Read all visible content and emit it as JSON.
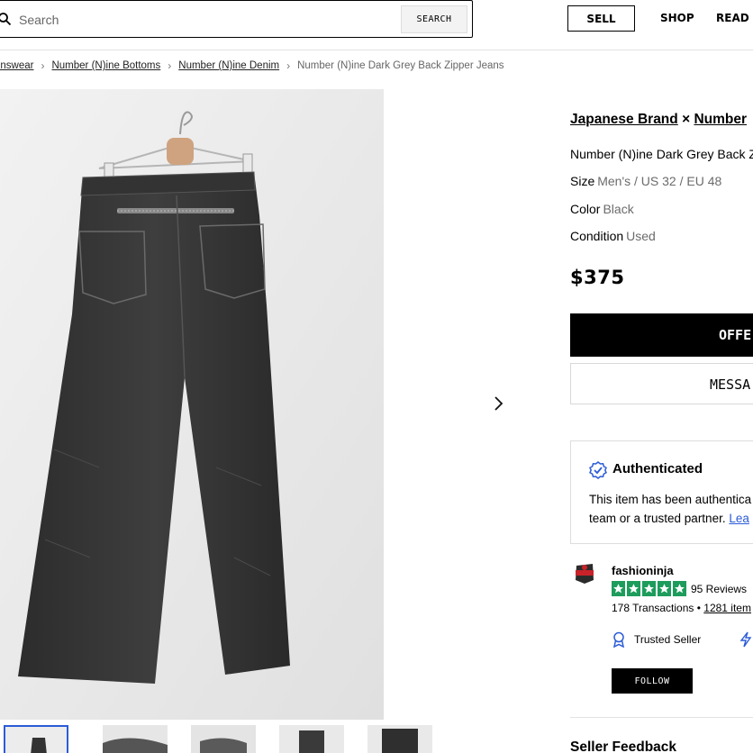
{
  "header": {
    "search_placeholder": "Search",
    "search_button": "SEARCH",
    "sell_button": "SELL",
    "nav": [
      "SHOP",
      "READ"
    ],
    "icons": {
      "search": "search-icon"
    }
  },
  "breadcrumb": [
    {
      "label": "Menswear",
      "shown": "enswear"
    },
    {
      "label": "Number (N)ine Bottoms"
    },
    {
      "label": "Number (N)ine Denim"
    },
    {
      "label": "Number (N)ine Dark Grey Back Zipper Jeans",
      "current": true
    }
  ],
  "product": {
    "designers": [
      "Japanese Brand",
      "×",
      "Number"
    ],
    "title": "Number (N)ine Dark Grey Back Z",
    "size_label": "Size",
    "size_value": "Men's / US 32 / EU 48",
    "color_label": "Color",
    "color_value": "Black",
    "condition_label": "Condition",
    "condition_value": "Used",
    "price": "$375",
    "offer_button": "OFFE",
    "message_button": "MESSA",
    "image_alt": "Dark grey jeans on hanger, back view",
    "thumbnail_count": 5
  },
  "authentication": {
    "title": "Authenticated",
    "text_line1": "This item has been authentica",
    "text_line2": "team or a trusted partner.",
    "link": "Lea",
    "icon": "verified-badge-icon"
  },
  "seller": {
    "name": "fashioninja",
    "rating_stars": 5,
    "reviews": "95 Reviews",
    "transactions": "178 Transactions",
    "bullet": "•",
    "items": "1281 item",
    "trusted": "Trusted Seller",
    "follow": "FOLLOW",
    "icons": {
      "trusted": "ribbon-icon",
      "quick": "lightning-icon"
    }
  },
  "feedback_heading": "Seller Feedback",
  "colors": {
    "star_green": "#1d9c5c",
    "link_blue": "#2b5bd7",
    "thumb_selected": "#2b5bd7"
  }
}
